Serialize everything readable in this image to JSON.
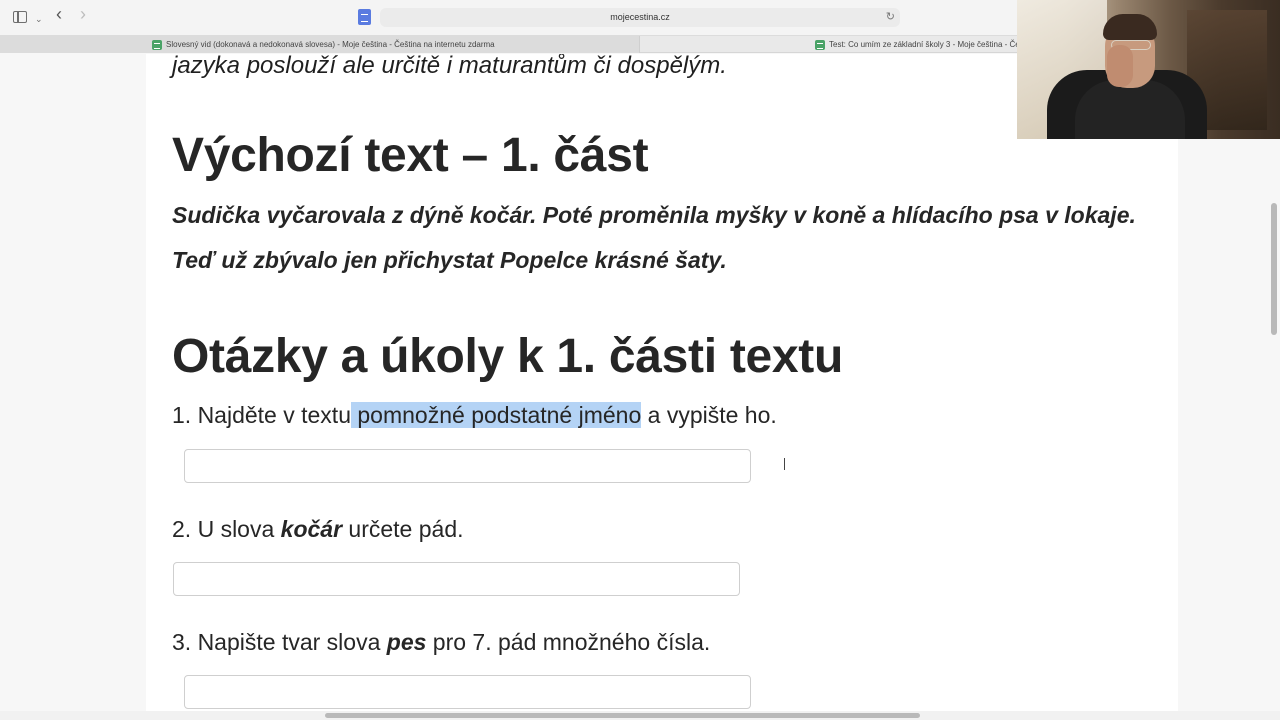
{
  "browser": {
    "url": "mojecestina.cz",
    "tabs": [
      {
        "title": "Slovesný vid (dokonavá a nedokonavá slovesa) - Moje čeština - Čeština na internetu zdarma"
      },
      {
        "title": "Test: Co umím ze základní školy 3 - Moje čeština - Če"
      }
    ],
    "icons": {
      "sidebar": "sidebar-icon",
      "back": "chevron-left-icon",
      "forward": "chevron-right-icon",
      "reload": "reload-icon"
    },
    "glyphs": {
      "chevron_down": "⌄",
      "back": "‹",
      "forward": "›",
      "reload": "↻"
    }
  },
  "page": {
    "lead_text": "jazyka poslouží ale určitě i maturantům či dospělým.",
    "section_source_heading": "Výchozí text – 1. část",
    "source_lines": [
      "Sudička vyčarovala z dýně kočár. Poté proměnila myšky v koně a hlídacího psa v lokaje.",
      "Teď už zbývalo jen přichystat Popelce krásné šaty."
    ],
    "section_questions_heading": "Otázky a úkoly k 1. části textu",
    "questions": [
      {
        "before": "1. Najděte v textu",
        "highlight": " pomnožné podstatné jméno",
        "after": " a vypište ho.",
        "answer": ""
      },
      {
        "before": "2. U slova ",
        "bold": "kočár",
        "after": " určete pád.",
        "answer": ""
      },
      {
        "before": "3. Napište tvar slova ",
        "bold": "pes",
        "after": " pro 7. pád množného čísla.",
        "answer": ""
      }
    ]
  },
  "colors": {
    "highlight": "#b4d3f5",
    "text": "#262626"
  }
}
